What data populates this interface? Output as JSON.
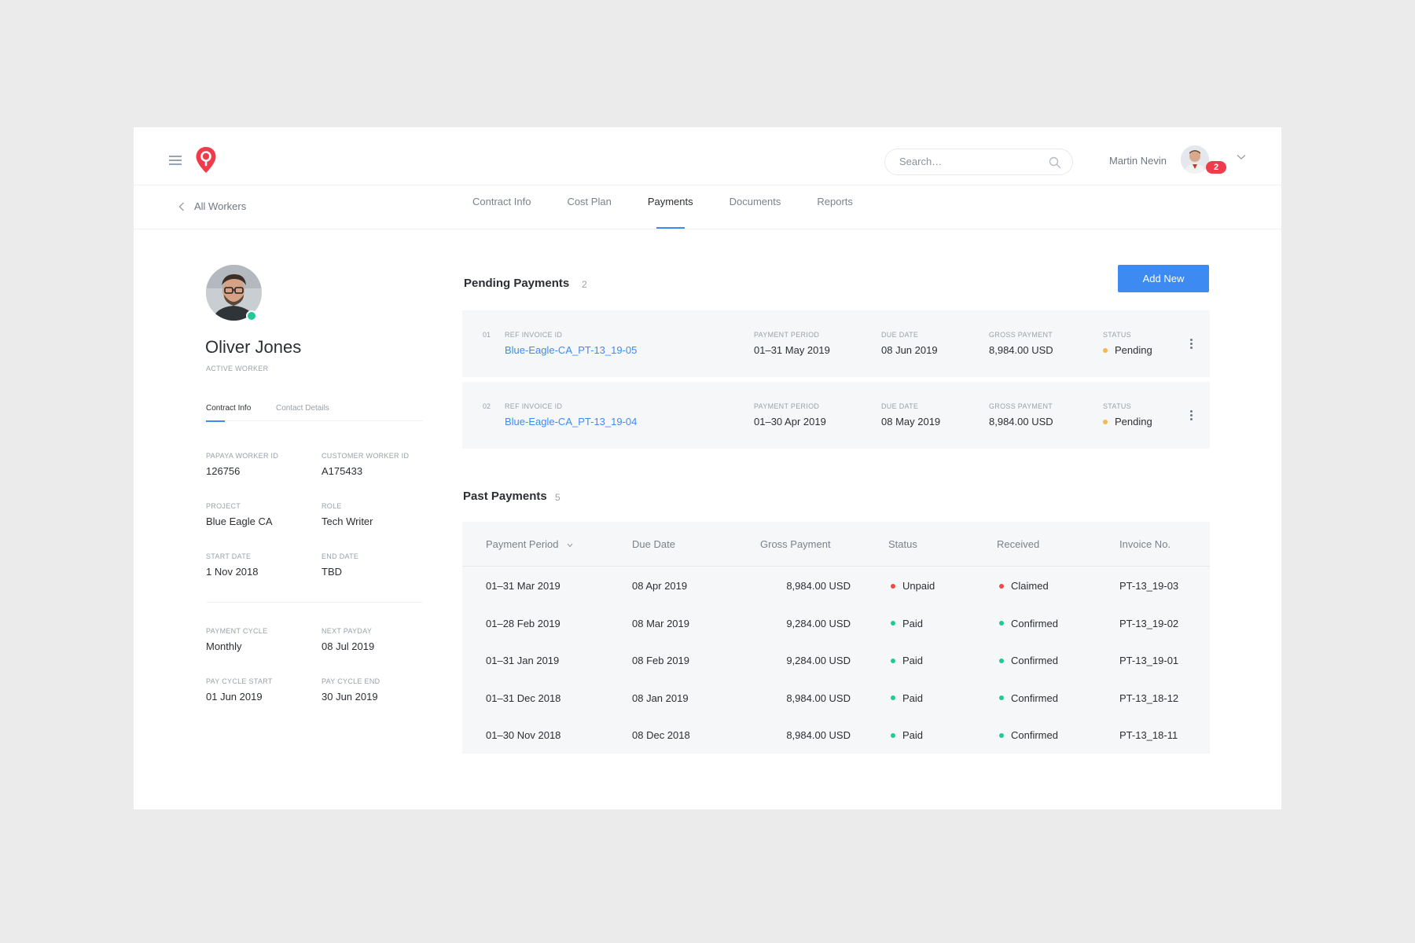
{
  "header": {
    "search_placeholder": "Search…",
    "user_name": "Martin Nevin",
    "notification_count": "2"
  },
  "subnav": {
    "back_label": "All Workers",
    "tabs": [
      {
        "label": "Contract Info"
      },
      {
        "label": "Cost Plan"
      },
      {
        "label": "Payments",
        "active": true
      },
      {
        "label": "Documents"
      },
      {
        "label": "Reports"
      }
    ]
  },
  "profile": {
    "name": "Oliver Jones",
    "status": "ACTIVE WORKER",
    "tabs": [
      "Contract Info",
      "Contact Details"
    ],
    "fields": {
      "papaya_worker_id": {
        "label": "PAPAYA WORKER ID",
        "value": "126756"
      },
      "customer_worker_id": {
        "label": "CUSTOMER WORKER ID",
        "value": "A175433"
      },
      "project": {
        "label": "PROJECT",
        "value": "Blue Eagle CA"
      },
      "role": {
        "label": "ROLE",
        "value": "Tech Writer"
      },
      "start_date": {
        "label": "START DATE",
        "value": "1 Nov 2018"
      },
      "end_date": {
        "label": "END DATE",
        "value": "TBD"
      },
      "payment_cycle": {
        "label": "PAYMENT CYCLE",
        "value": "Monthly"
      },
      "next_payday": {
        "label": "NEXT PAYDAY",
        "value": "08 Jul 2019"
      },
      "pay_cycle_start": {
        "label": "PAY CYCLE START",
        "value": "01 Jun 2019"
      },
      "pay_cycle_end": {
        "label": "PAY CYCLE END",
        "value": "30 Jun 2019"
      }
    }
  },
  "pending": {
    "title": "Pending Payments",
    "count": "2",
    "add_label": "Add New",
    "labels": {
      "ref": "REF INVOICE ID",
      "period": "PAYMENT PERIOD",
      "due": "DUE DATE",
      "gross": "GROSS PAYMENT",
      "status": "STATUS"
    },
    "items": [
      {
        "num": "01",
        "ref": "Blue-Eagle-CA_PT-13_19-05",
        "period": "01–31 May 2019",
        "due": "08 Jun 2019",
        "gross": "8,984.00 USD",
        "status": "Pending"
      },
      {
        "num": "02",
        "ref": "Blue-Eagle-CA_PT-13_19-04",
        "period": "01–30 Apr 2019",
        "due": "08 May 2019",
        "gross": "8,984.00 USD",
        "status": "Pending"
      }
    ]
  },
  "past": {
    "title": "Past Payments",
    "count": "5",
    "columns": [
      "Payment Period",
      "Due Date",
      "Gross Payment",
      "Status",
      "Received",
      "Invoice No."
    ],
    "rows": [
      {
        "period": "01–31 Mar 2019",
        "due": "08 Apr 2019",
        "gross": "8,984.00 USD",
        "status": "Unpaid",
        "received": "Claimed",
        "invoice": "PT-13_19-03"
      },
      {
        "period": "01–28 Feb 2019",
        "due": "08 Mar 2019",
        "gross": "9,284.00 USD",
        "status": "Paid",
        "received": "Confirmed",
        "invoice": "PT-13_19-02"
      },
      {
        "period": "01–31 Jan 2019",
        "due": "08 Feb 2019",
        "gross": "9,284.00 USD",
        "status": "Paid",
        "received": "Confirmed",
        "invoice": "PT-13_19-01"
      },
      {
        "period": "01–31 Dec 2018",
        "due": "08 Jan 2019",
        "gross": "8,984.00 USD",
        "status": "Paid",
        "received": "Confirmed",
        "invoice": "PT-13_18-12"
      },
      {
        "period": "01–30 Nov 2018",
        "due": "08 Dec 2018",
        "gross": "8,984.00 USD",
        "status": "Paid",
        "received": "Confirmed",
        "invoice": "PT-13_18-11"
      }
    ]
  },
  "colors": {
    "accent": "#3d8bf2",
    "pending": "#f5b84c",
    "paid": "#20c997",
    "unpaid": "#ef4a4a",
    "brand": "#ef3b4a"
  }
}
